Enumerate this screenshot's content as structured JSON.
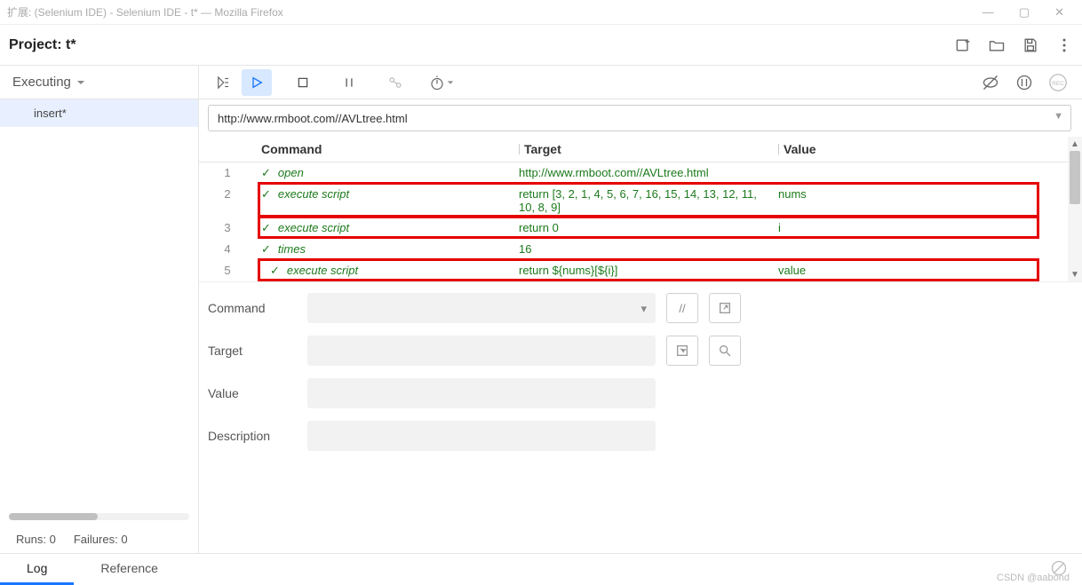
{
  "window": {
    "title": "扩展:  (Selenium IDE) - Selenium IDE - t* — Mozilla Firefox"
  },
  "project": {
    "label": "Project:",
    "name": "t*"
  },
  "sidebar": {
    "header": "Executing",
    "items": [
      "insert*"
    ],
    "runs_label": "Runs:",
    "runs_value": "0",
    "failures_label": "Failures:",
    "failures_value": "0"
  },
  "url": "http://www.rmboot.com//AVLtree.html",
  "columns": {
    "command": "Command",
    "target": "Target",
    "value": "Value"
  },
  "rows": [
    {
      "n": "1",
      "command": "open",
      "target": "http://www.rmboot.com//AVLtree.html",
      "value": "",
      "highlighted": false
    },
    {
      "n": "2",
      "command": "execute script",
      "target": "return [3, 2, 1, 4, 5, 6, 7, 16, 15, 14, 13, 12, 11, 10, 8, 9]",
      "value": "nums",
      "highlighted": true
    },
    {
      "n": "3",
      "command": "execute script",
      "target": "return 0",
      "value": "i",
      "highlighted": true
    },
    {
      "n": "4",
      "command": "times",
      "target": "16",
      "value": "",
      "highlighted": false
    },
    {
      "n": "5",
      "command": "execute script",
      "target": "return ${nums}[${i}]",
      "value": "value",
      "highlighted": true,
      "indent": true
    }
  ],
  "detail": {
    "command_label": "Command",
    "target_label": "Target",
    "value_label": "Value",
    "description_label": "Description"
  },
  "tabs": {
    "log": "Log",
    "reference": "Reference"
  },
  "watermark": "CSDN @aabond"
}
